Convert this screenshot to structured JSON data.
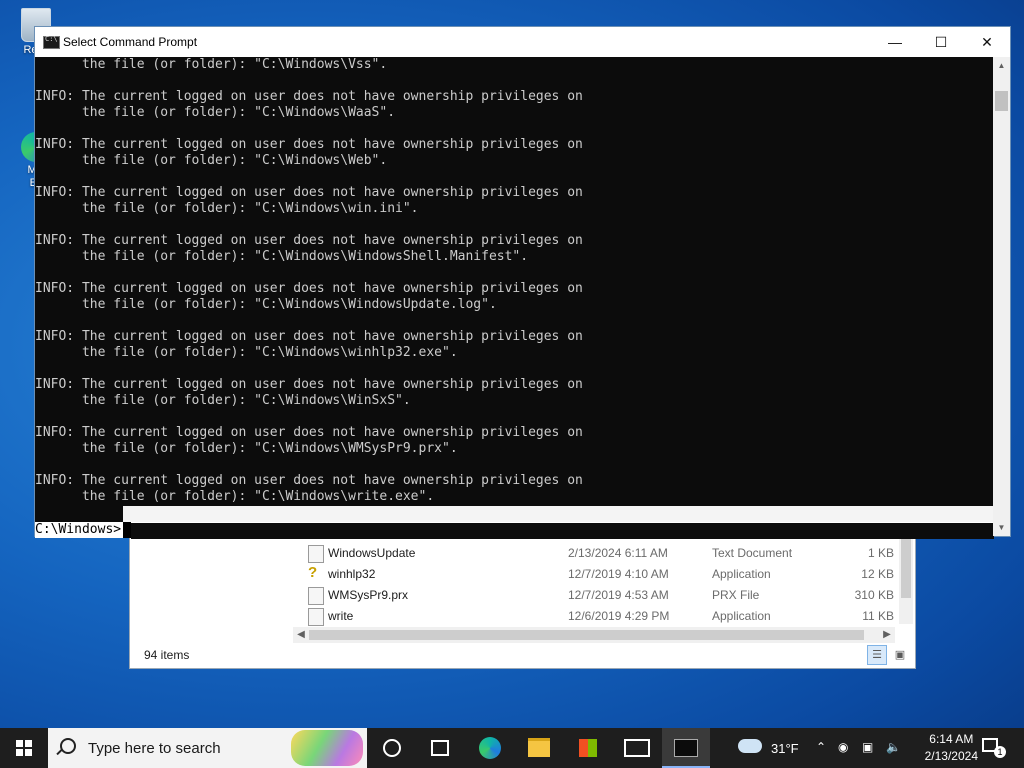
{
  "desktop": {
    "icons": [
      {
        "label": "Recy"
      },
      {
        "label": "Mic"
      },
      {
        "label": "Ec"
      }
    ]
  },
  "explorer": {
    "rows": [
      {
        "name": "WindowsUpdate",
        "date": "2/13/2024 6:11 AM",
        "type": "Text Document",
        "size": "1 KB",
        "icon": "text-file-icon"
      },
      {
        "name": "winhlp32",
        "date": "12/7/2019 4:10 AM",
        "type": "Application",
        "size": "12 KB",
        "icon": "help-app-icon"
      },
      {
        "name": "WMSysPr9.prx",
        "date": "12/7/2019 4:53 AM",
        "type": "PRX File",
        "size": "310 KB",
        "icon": "file-icon"
      },
      {
        "name": "write",
        "date": "12/6/2019 4:29 PM",
        "type": "Application",
        "size": "11 KB",
        "icon": "write-app-icon"
      }
    ],
    "status": "94 items"
  },
  "cmd": {
    "title": "Select Command Prompt",
    "controls": {
      "minimize": "—",
      "maximize": "☐",
      "close": "✕"
    },
    "output": "      the file (or folder): \"C:\\Windows\\Vss\".\n\nINFO: The current logged on user does not have ownership privileges on\n      the file (or folder): \"C:\\Windows\\WaaS\".\n\nINFO: The current logged on user does not have ownership privileges on\n      the file (or folder): \"C:\\Windows\\Web\".\n\nINFO: The current logged on user does not have ownership privileges on\n      the file (or folder): \"C:\\Windows\\win.ini\".\n\nINFO: The current logged on user does not have ownership privileges on\n      the file (or folder): \"C:\\Windows\\WindowsShell.Manifest\".\n\nINFO: The current logged on user does not have ownership privileges on\n      the file (or folder): \"C:\\Windows\\WindowsUpdate.log\".\n\nINFO: The current logged on user does not have ownership privileges on\n      the file (or folder): \"C:\\Windows\\winhlp32.exe\".\n\nINFO: The current logged on user does not have ownership privileges on\n      the file (or folder): \"C:\\Windows\\WinSxS\".\n\nINFO: The current logged on user does not have ownership privileges on\n      the file (or folder): \"C:\\Windows\\WMSysPr9.prx\".\n\nINFO: The current logged on user does not have ownership privileges on\n      the file (or folder): \"C:\\Windows\\write.exe\".",
    "prompt": "C:\\Windows>"
  },
  "taskbar": {
    "search_placeholder": "Type here to search",
    "weather_temp": "31°F",
    "time": "6:14 AM",
    "date": "2/13/2024",
    "notification_count": "1"
  }
}
